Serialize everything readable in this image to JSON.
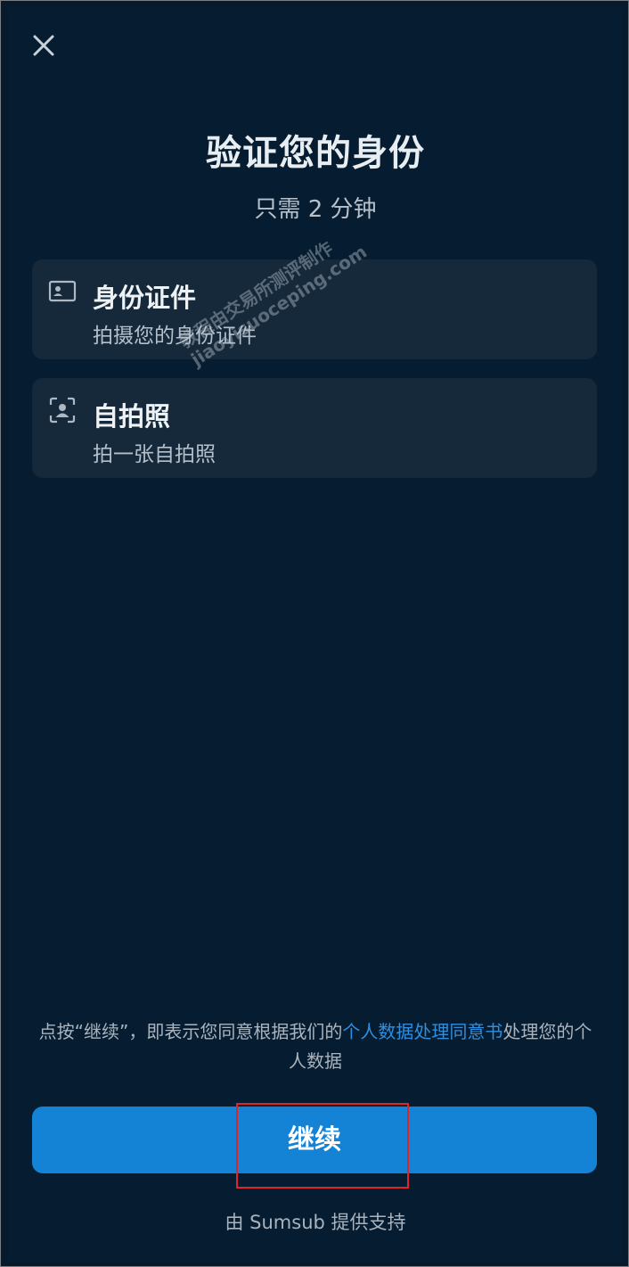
{
  "header": {
    "close_icon": "close-icon"
  },
  "main": {
    "title": "验证您的身份",
    "subtitle": "只需 2 分钟"
  },
  "steps": [
    {
      "icon": "id-card-icon",
      "title": "身份证件",
      "description": "拍摄您的身份证件"
    },
    {
      "icon": "selfie-icon",
      "title": "自拍照",
      "description": "拍一张自拍照"
    }
  ],
  "watermark": {
    "line1": "教程由交易所测评制作",
    "line2": "jiaoyisuoceping.com"
  },
  "consent": {
    "prefix": "点按“继续”，即表示您同意根据我们的",
    "link_text": "个人数据处理同意书",
    "suffix": "处理您的个人数据"
  },
  "continue_button": {
    "label": "继续"
  },
  "footer": {
    "powered_by": "由 Sumsub 提供支持"
  },
  "colors": {
    "background": "#061c30",
    "card": "#15293b",
    "accent": "#1483d6",
    "link": "#2e8fe0",
    "highlight": "#e0242b"
  }
}
